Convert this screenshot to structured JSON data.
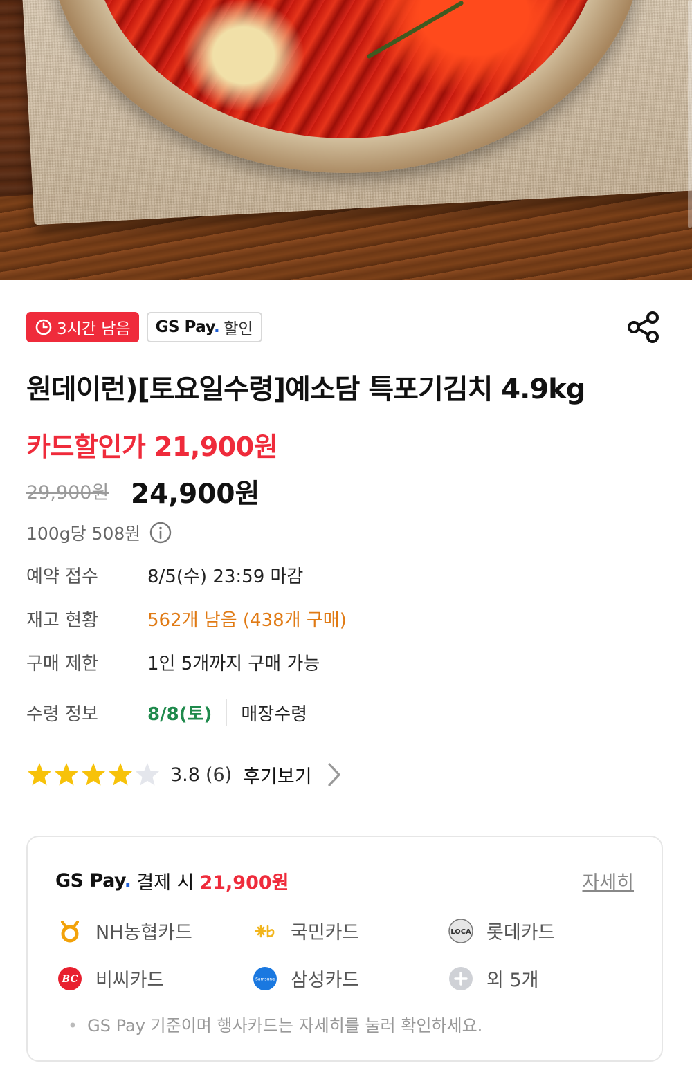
{
  "badges": {
    "time_left": "3시간 남음",
    "gspay_brand": "GS Pay",
    "gspay_suffix": "할인"
  },
  "product": {
    "title": "원데이런)[토요일수령]예소담 특포기김치 4.9kg",
    "card_price": "카드할인가 21,900원",
    "original_price": "29,900원",
    "sale_price": "24,900원",
    "unit_price": "100g당 508원"
  },
  "info": [
    {
      "label": "예약 접수",
      "value": "8/5(수) 23:59 마감"
    },
    {
      "label": "재고 현황",
      "value": "562개 남음 (438개 구매)"
    },
    {
      "label": "구매 제한",
      "value": "1인 5개까지 구매 가능"
    }
  ],
  "pickup": {
    "label": "수령 정보",
    "date": "8/8(토)",
    "method": "매장수령"
  },
  "rating": {
    "score": 3.8,
    "score_text": "3.8",
    "count_text": "(6)",
    "review_link": "후기보기",
    "stars_filled": 4,
    "stars_total": 5
  },
  "gspay": {
    "brand": "GS Pay",
    "prefix": "결제 시",
    "amount": "21,900원",
    "detail_link": "자세히",
    "cards": [
      {
        "name": "NH농협카드",
        "icon": "nh-card-icon"
      },
      {
        "name": "국민카드",
        "icon": "kb-card-icon"
      },
      {
        "name": "롯데카드",
        "icon": "lotte-card-icon"
      },
      {
        "name": "비씨카드",
        "icon": "bc-card-icon"
      },
      {
        "name": "삼성카드",
        "icon": "samsung-card-icon"
      },
      {
        "name": "외 5개",
        "icon": "plus-icon"
      }
    ],
    "note": "GS Pay 기준이며 행사카드는 자세히를 눌러 확인하세요.",
    "samsung_logo_text": "Samsung",
    "lotte_logo_text": "LOCA"
  },
  "colors": {
    "accent_red": "#ef2b3b",
    "stock_orange": "#e07a14",
    "pickup_green": "#1f8a4c",
    "star_yellow": "#f7c20a"
  }
}
